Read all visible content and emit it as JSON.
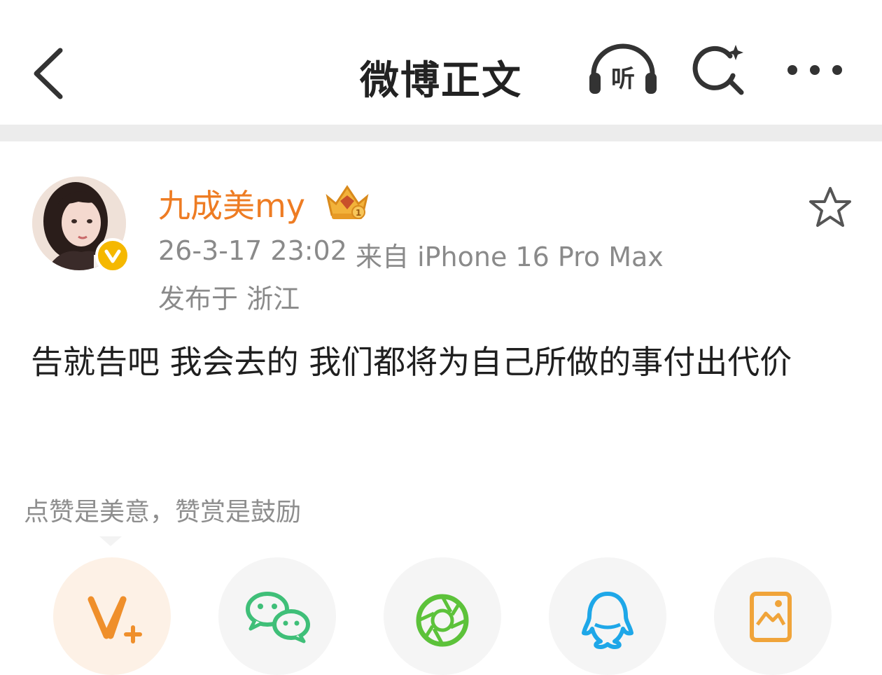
{
  "header": {
    "title": "微博正文",
    "listen_label": "听",
    "icons": [
      "back-arrow-icon",
      "headphones-icon",
      "search-icon",
      "more-icon"
    ]
  },
  "post": {
    "author": {
      "name": "九成美my",
      "verified": true,
      "badge": "crown-level-1-icon"
    },
    "time": "26-3-17 23:02",
    "source": "来自 iPhone 16 Pro Max",
    "location": "发布于 浙江",
    "content": "告就告吧 我会去的 我们都将为自己所做的事付出代价"
  },
  "reward": {
    "hint": "点赞是美意，赞赏是鼓励"
  },
  "share": [
    {
      "name": "vplus",
      "icon": "vplus-icon"
    },
    {
      "name": "wechat",
      "icon": "wechat-icon"
    },
    {
      "name": "moments",
      "icon": "wechat-moments-icon"
    },
    {
      "name": "qq",
      "icon": "qq-icon"
    },
    {
      "name": "album",
      "icon": "album-icon"
    }
  ],
  "colors": {
    "accent": "#ee7c23",
    "meta_text": "#8a8a8a",
    "separator": "#ececec",
    "verified": "#f5b800",
    "wechat": "#3fbf78",
    "moments": "#5cc23a",
    "qq": "#1ea7e8"
  }
}
